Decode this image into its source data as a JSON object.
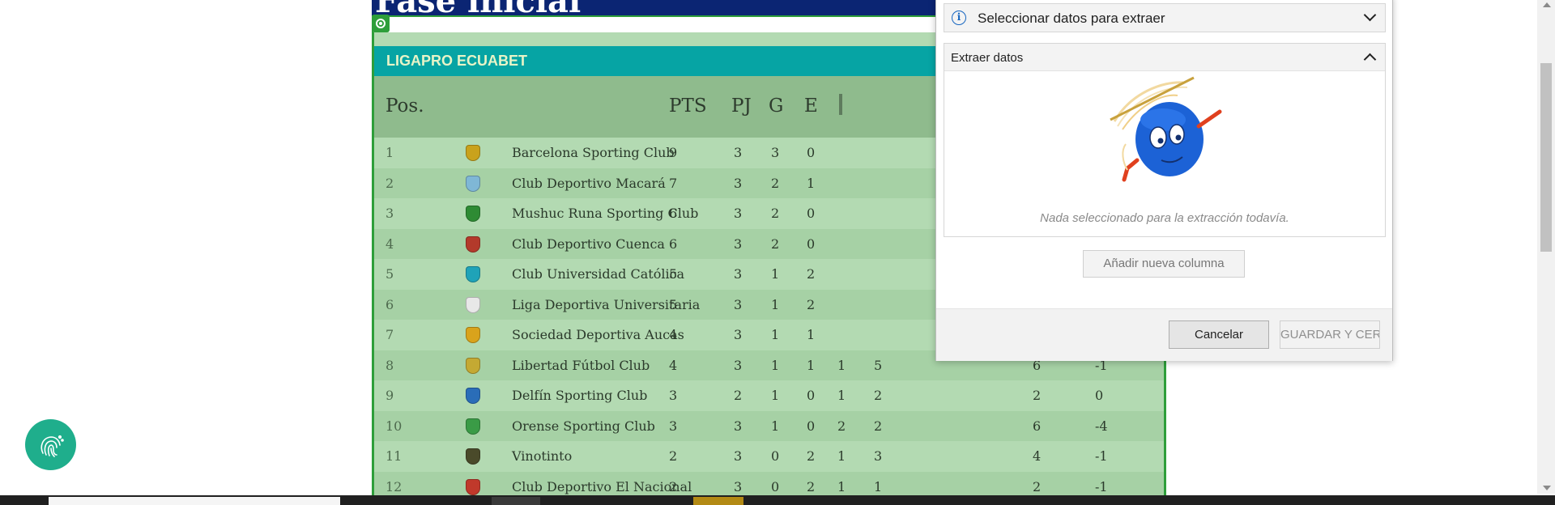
{
  "page": {
    "title": "Fase inicial",
    "league_name": "LIGAPRO ECUABET",
    "columns": [
      "Pos.",
      "PTS",
      "PJ",
      "G",
      "E"
    ],
    "teams": [
      {
        "pos": "1",
        "name": "Barcelona Sporting Club",
        "pts": "9",
        "pj": "3",
        "g": "3",
        "e": "0",
        "p": "",
        "gf": "",
        "gc": "",
        "gd": "",
        "badge": "#c9a21c"
      },
      {
        "pos": "2",
        "name": "Club Deportivo Macará",
        "pts": "7",
        "pj": "3",
        "g": "2",
        "e": "1",
        "p": "",
        "gf": "",
        "gc": "",
        "gd": "",
        "badge": "#7fb7d6"
      },
      {
        "pos": "3",
        "name": "Mushuc Runa Sporting Club",
        "pts": "6",
        "pj": "3",
        "g": "2",
        "e": "0",
        "p": "",
        "gf": "",
        "gc": "",
        "gd": "",
        "badge": "#2e8b34"
      },
      {
        "pos": "4",
        "name": "Club Deportivo Cuenca",
        "pts": "6",
        "pj": "3",
        "g": "2",
        "e": "0",
        "p": "",
        "gf": "",
        "gc": "",
        "gd": "",
        "badge": "#b33a2b"
      },
      {
        "pos": "5",
        "name": "Club Universidad Católica",
        "pts": "5",
        "pj": "3",
        "g": "1",
        "e": "2",
        "p": "",
        "gf": "",
        "gc": "",
        "gd": "",
        "badge": "#1fa3b8"
      },
      {
        "pos": "6",
        "name": "Liga Deportiva Universitaria",
        "pts": "5",
        "pj": "3",
        "g": "1",
        "e": "2",
        "p": "",
        "gf": "",
        "gc": "",
        "gd": "",
        "badge": "#e8e8e8"
      },
      {
        "pos": "7",
        "name": "Sociedad Deportiva Aucas",
        "pts": "4",
        "pj": "3",
        "g": "1",
        "e": "1",
        "p": "",
        "gf": "",
        "gc": "",
        "gd": "",
        "badge": "#d9a31c"
      },
      {
        "pos": "8",
        "name": "Libertad Fútbol Club",
        "pts": "4",
        "pj": "3",
        "g": "1",
        "e": "1",
        "p": "1",
        "gf": "5",
        "gc": "6",
        "gd": "-1",
        "badge": "#c4a933"
      },
      {
        "pos": "9",
        "name": "Delfín Sporting Club",
        "pts": "3",
        "pj": "2",
        "g": "1",
        "e": "0",
        "p": "1",
        "gf": "2",
        "gc": "2",
        "gd": "0",
        "badge": "#2a6db8"
      },
      {
        "pos": "10",
        "name": "Orense Sporting Club",
        "pts": "3",
        "pj": "3",
        "g": "1",
        "e": "0",
        "p": "2",
        "gf": "2",
        "gc": "6",
        "gd": "-4",
        "badge": "#3a9b46"
      },
      {
        "pos": "11",
        "name": "Vinotinto",
        "pts": "2",
        "pj": "3",
        "g": "0",
        "e": "2",
        "p": "1",
        "gf": "3",
        "gc": "4",
        "gd": "-1",
        "badge": "#4a4a2a"
      },
      {
        "pos": "12",
        "name": "Club Deportivo El Nacional",
        "pts": "2",
        "pj": "3",
        "g": "0",
        "e": "2",
        "p": "1",
        "gf": "1",
        "gc": "2",
        "gd": "-1",
        "badge": "#c0392b"
      }
    ]
  },
  "dialog": {
    "select_label": "Seleccionar datos para extraer",
    "extract_title": "Extraer datos",
    "empty_message": "Nada seleccionado para la extracción todavía.",
    "add_column_label": "Añadir nueva columna",
    "cancel_label": "Cancelar",
    "save_label": "GUARDAR Y CER"
  },
  "icons": {
    "info": "info-icon",
    "dropdown": "chevron-down-icon",
    "collapse": "chevron-up-icon",
    "fingerprint": "fingerprint-icon"
  },
  "colors": {
    "title_bar": "#0b2573",
    "league_bar": "#06a4a4",
    "selection": "#2e9e3a",
    "table_bg": "#b3dab2",
    "header_bg": "#8fbb8d",
    "fingerprint_button": "#1fae8c"
  }
}
